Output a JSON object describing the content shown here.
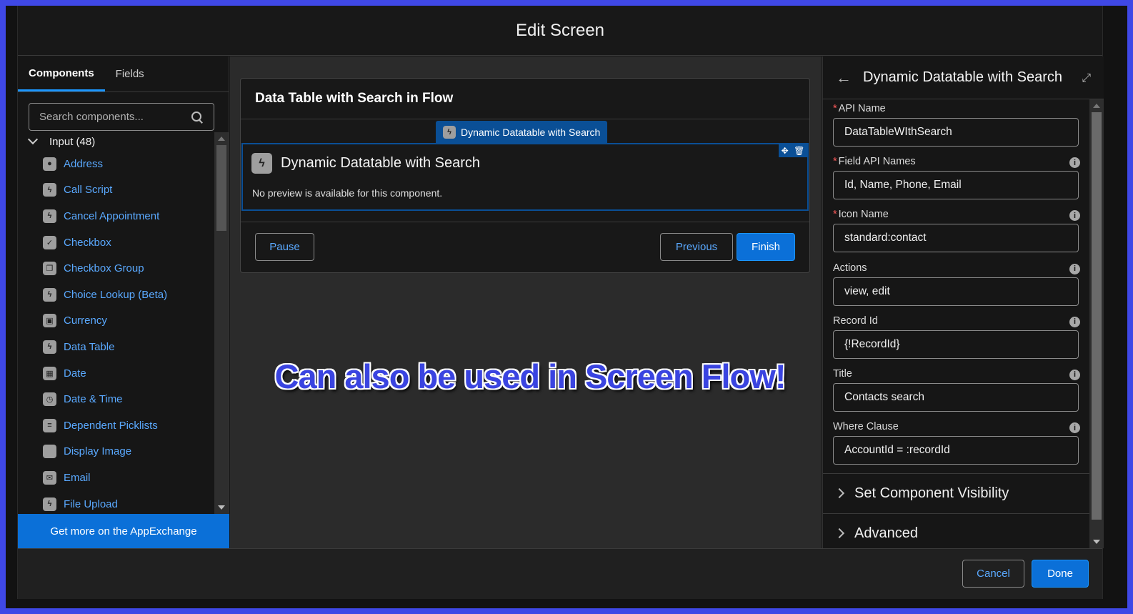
{
  "modal": {
    "title": "Edit Screen"
  },
  "left": {
    "tabs": [
      {
        "label": "Components",
        "active": true
      },
      {
        "label": "Fields",
        "active": false
      }
    ],
    "search_placeholder": "Search components...",
    "group": "Input (48)",
    "items": [
      {
        "label": "Address",
        "icon": "location-pin-icon"
      },
      {
        "label": "Call Script",
        "icon": "bolt-icon"
      },
      {
        "label": "Cancel Appointment",
        "icon": "bolt-icon"
      },
      {
        "label": "Checkbox",
        "icon": "checkbox-icon"
      },
      {
        "label": "Checkbox Group",
        "icon": "checkbox-group-icon"
      },
      {
        "label": "Choice Lookup (Beta)",
        "icon": "bolt-icon"
      },
      {
        "label": "Currency",
        "icon": "currency-icon"
      },
      {
        "label": "Data Table",
        "icon": "bolt-icon"
      },
      {
        "label": "Date",
        "icon": "calendar-icon"
      },
      {
        "label": "Date & Time",
        "icon": "calendar-clock-icon"
      },
      {
        "label": "Dependent Picklists",
        "icon": "list-icon"
      },
      {
        "label": "Display Image",
        "icon": "image-icon"
      },
      {
        "label": "Email",
        "icon": "email-icon"
      },
      {
        "label": "File Upload",
        "icon": "bolt-icon"
      }
    ],
    "appexchange_label": "Get more on the AppExchange"
  },
  "canvas": {
    "screen_title": "Data Table with Search in Flow",
    "component_tag": "Dynamic Datatable with Search",
    "component_name": "Dynamic Datatable with Search",
    "component_note": "No preview is available for this component.",
    "pause_label": "Pause",
    "previous_label": "Previous",
    "finish_label": "Finish",
    "overlay_text": "Can also be used in Screen Flow!"
  },
  "right": {
    "title": "Dynamic Datatable with Search",
    "properties": [
      {
        "label": "API Name",
        "required": true,
        "info": false,
        "value": "DataTableWIthSearch"
      },
      {
        "label": "Field API Names",
        "required": true,
        "info": true,
        "value": "Id, Name, Phone, Email"
      },
      {
        "label": "Icon Name",
        "required": true,
        "info": true,
        "value": "standard:contact"
      },
      {
        "label": "Actions",
        "required": false,
        "info": true,
        "value": "view, edit"
      },
      {
        "label": "Record Id",
        "required": false,
        "info": true,
        "value": "{!RecordId}"
      },
      {
        "label": "Title",
        "required": false,
        "info": true,
        "value": "Contacts search"
      },
      {
        "label": "Where Clause",
        "required": false,
        "info": true,
        "value": "AccountId = :recordId"
      }
    ],
    "sections": [
      {
        "label": "Set Component Visibility"
      },
      {
        "label": "Advanced"
      }
    ]
  },
  "footer": {
    "cancel_label": "Cancel",
    "done_label": "Done"
  },
  "colors": {
    "frame_border": "#3f48e6",
    "accent": "#0b70d8",
    "link": "#5aa9ff",
    "required": "#ff5a5a"
  }
}
